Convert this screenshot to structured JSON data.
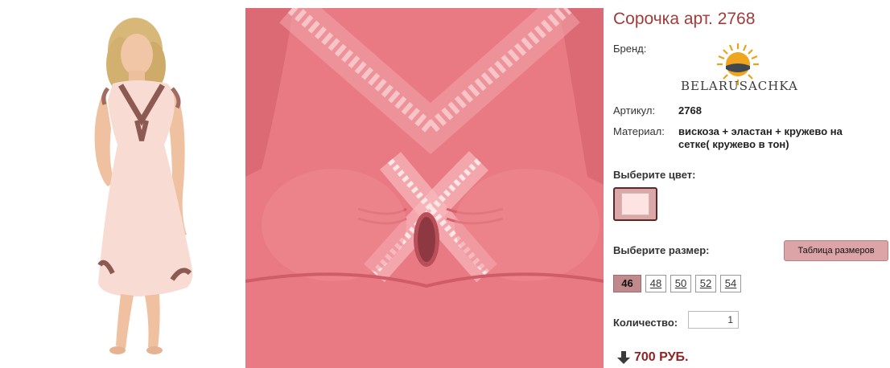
{
  "product": {
    "title": "Сорочка арт. 2768",
    "brand_label": "Бренд:",
    "brand_logo_text": "BELARUSACHKA",
    "article_label": "Артикул:",
    "article_value": "2768",
    "material_label": "Материал:",
    "material_value": "вискоза + эластан + кружево на сетке( кружево в тон)"
  },
  "color_picker": {
    "heading": "Выберите цвет:",
    "selected_color": "#fde3e1"
  },
  "size_picker": {
    "heading": "Выберите размер:",
    "table_button": "Таблица размеров",
    "sizes": [
      "46",
      "48",
      "50",
      "52",
      "54"
    ],
    "selected": "46"
  },
  "quantity": {
    "label": "Количество:",
    "value": "1"
  },
  "price": {
    "value": "700 РУБ."
  },
  "colors": {
    "accent": "#a23b3b",
    "price": "#8e2424",
    "garment": "#e97a83"
  }
}
